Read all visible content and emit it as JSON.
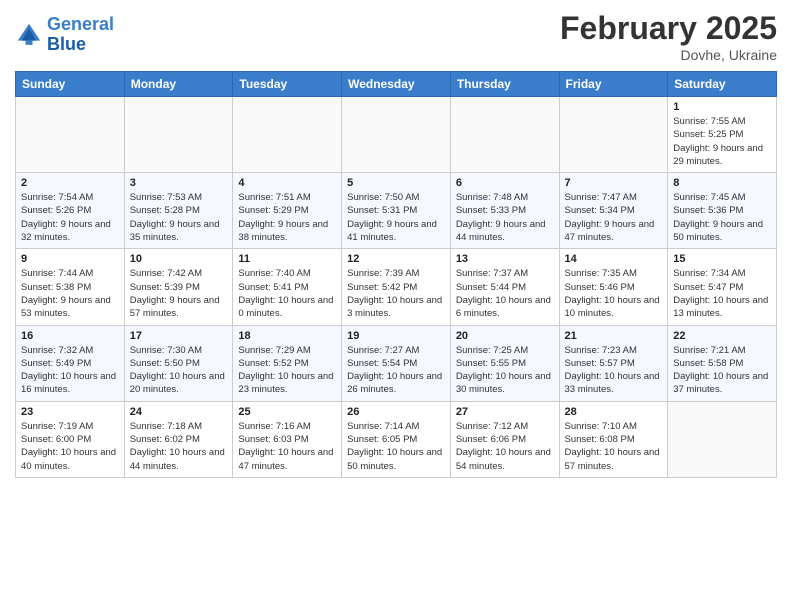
{
  "header": {
    "logo_line1": "General",
    "logo_line2": "Blue",
    "month_title": "February 2025",
    "location": "Dovhe, Ukraine"
  },
  "days_of_week": [
    "Sunday",
    "Monday",
    "Tuesday",
    "Wednesday",
    "Thursday",
    "Friday",
    "Saturday"
  ],
  "weeks": [
    [
      {
        "day": "",
        "info": ""
      },
      {
        "day": "",
        "info": ""
      },
      {
        "day": "",
        "info": ""
      },
      {
        "day": "",
        "info": ""
      },
      {
        "day": "",
        "info": ""
      },
      {
        "day": "",
        "info": ""
      },
      {
        "day": "1",
        "info": "Sunrise: 7:55 AM\nSunset: 5:25 PM\nDaylight: 9 hours and 29 minutes."
      }
    ],
    [
      {
        "day": "2",
        "info": "Sunrise: 7:54 AM\nSunset: 5:26 PM\nDaylight: 9 hours and 32 minutes."
      },
      {
        "day": "3",
        "info": "Sunrise: 7:53 AM\nSunset: 5:28 PM\nDaylight: 9 hours and 35 minutes."
      },
      {
        "day": "4",
        "info": "Sunrise: 7:51 AM\nSunset: 5:29 PM\nDaylight: 9 hours and 38 minutes."
      },
      {
        "day": "5",
        "info": "Sunrise: 7:50 AM\nSunset: 5:31 PM\nDaylight: 9 hours and 41 minutes."
      },
      {
        "day": "6",
        "info": "Sunrise: 7:48 AM\nSunset: 5:33 PM\nDaylight: 9 hours and 44 minutes."
      },
      {
        "day": "7",
        "info": "Sunrise: 7:47 AM\nSunset: 5:34 PM\nDaylight: 9 hours and 47 minutes."
      },
      {
        "day": "8",
        "info": "Sunrise: 7:45 AM\nSunset: 5:36 PM\nDaylight: 9 hours and 50 minutes."
      }
    ],
    [
      {
        "day": "9",
        "info": "Sunrise: 7:44 AM\nSunset: 5:38 PM\nDaylight: 9 hours and 53 minutes."
      },
      {
        "day": "10",
        "info": "Sunrise: 7:42 AM\nSunset: 5:39 PM\nDaylight: 9 hours and 57 minutes."
      },
      {
        "day": "11",
        "info": "Sunrise: 7:40 AM\nSunset: 5:41 PM\nDaylight: 10 hours and 0 minutes."
      },
      {
        "day": "12",
        "info": "Sunrise: 7:39 AM\nSunset: 5:42 PM\nDaylight: 10 hours and 3 minutes."
      },
      {
        "day": "13",
        "info": "Sunrise: 7:37 AM\nSunset: 5:44 PM\nDaylight: 10 hours and 6 minutes."
      },
      {
        "day": "14",
        "info": "Sunrise: 7:35 AM\nSunset: 5:46 PM\nDaylight: 10 hours and 10 minutes."
      },
      {
        "day": "15",
        "info": "Sunrise: 7:34 AM\nSunset: 5:47 PM\nDaylight: 10 hours and 13 minutes."
      }
    ],
    [
      {
        "day": "16",
        "info": "Sunrise: 7:32 AM\nSunset: 5:49 PM\nDaylight: 10 hours and 16 minutes."
      },
      {
        "day": "17",
        "info": "Sunrise: 7:30 AM\nSunset: 5:50 PM\nDaylight: 10 hours and 20 minutes."
      },
      {
        "day": "18",
        "info": "Sunrise: 7:29 AM\nSunset: 5:52 PM\nDaylight: 10 hours and 23 minutes."
      },
      {
        "day": "19",
        "info": "Sunrise: 7:27 AM\nSunset: 5:54 PM\nDaylight: 10 hours and 26 minutes."
      },
      {
        "day": "20",
        "info": "Sunrise: 7:25 AM\nSunset: 5:55 PM\nDaylight: 10 hours and 30 minutes."
      },
      {
        "day": "21",
        "info": "Sunrise: 7:23 AM\nSunset: 5:57 PM\nDaylight: 10 hours and 33 minutes."
      },
      {
        "day": "22",
        "info": "Sunrise: 7:21 AM\nSunset: 5:58 PM\nDaylight: 10 hours and 37 minutes."
      }
    ],
    [
      {
        "day": "23",
        "info": "Sunrise: 7:19 AM\nSunset: 6:00 PM\nDaylight: 10 hours and 40 minutes."
      },
      {
        "day": "24",
        "info": "Sunrise: 7:18 AM\nSunset: 6:02 PM\nDaylight: 10 hours and 44 minutes."
      },
      {
        "day": "25",
        "info": "Sunrise: 7:16 AM\nSunset: 6:03 PM\nDaylight: 10 hours and 47 minutes."
      },
      {
        "day": "26",
        "info": "Sunrise: 7:14 AM\nSunset: 6:05 PM\nDaylight: 10 hours and 50 minutes."
      },
      {
        "day": "27",
        "info": "Sunrise: 7:12 AM\nSunset: 6:06 PM\nDaylight: 10 hours and 54 minutes."
      },
      {
        "day": "28",
        "info": "Sunrise: 7:10 AM\nSunset: 6:08 PM\nDaylight: 10 hours and 57 minutes."
      },
      {
        "day": "",
        "info": ""
      }
    ]
  ]
}
